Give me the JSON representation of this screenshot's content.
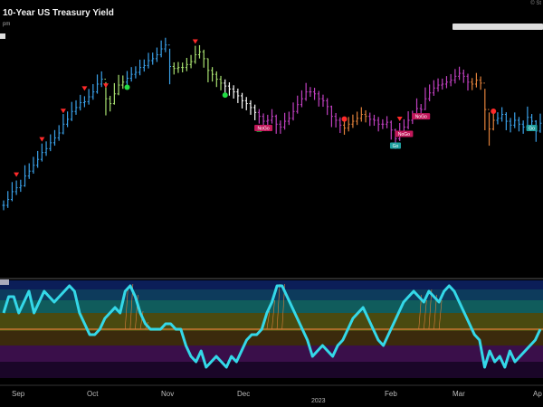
{
  "header": {
    "title": "10-Year US Treasury Yield",
    "subtitle": "pm",
    "copyright": "© St"
  },
  "chart_data": {
    "type": "line",
    "title": "10-Year US Treasury Yield",
    "x_axis_ticks": [
      "Sep",
      "Oct",
      "Nov",
      "Dec",
      "2023",
      "Feb",
      "Mar",
      "Ap"
    ],
    "price_panel": {
      "style": "colored OHLC bars",
      "series": [
        {
          "values": [
            2.72,
            2.78,
            2.86,
            2.9,
            2.92,
            3.02,
            3.07,
            3.13,
            3.19,
            3.26,
            3.3,
            3.36,
            3.41,
            3.46,
            3.55,
            3.6,
            3.68,
            3.72,
            3.77,
            3.78,
            3.83,
            3.88,
            3.96,
            4.01,
            3.81,
            3.76,
            3.86,
            3.95,
            3.98,
            4.02,
            4.06,
            4.08,
            4.13,
            4.15,
            4.2,
            4.22,
            4.26,
            4.32,
            4.36,
            4.14,
            4.12,
            4.13,
            4.13,
            4.16,
            4.19,
            4.26,
            4.29,
            4.22,
            4.1,
            4.06,
            4.01,
            3.97,
            3.94,
            3.91,
            3.88,
            3.84,
            3.79,
            3.76,
            3.72,
            3.67,
            3.63,
            3.58,
            3.59,
            3.63,
            3.55,
            3.52,
            3.58,
            3.61,
            3.68,
            3.75,
            3.81,
            3.88,
            3.88,
            3.86,
            3.81,
            3.79,
            3.73,
            3.63,
            3.59,
            3.54,
            3.51,
            3.55,
            3.58,
            3.61,
            3.65,
            3.63,
            3.6,
            3.59,
            3.55,
            3.55,
            3.57,
            3.49,
            3.4,
            3.47,
            3.52,
            3.59,
            3.62,
            3.71,
            3.7,
            3.81,
            3.87,
            3.92,
            3.95,
            3.96,
            3.98,
            4.0,
            4.04,
            4.07,
            4.04,
            3.98,
            3.96,
            4.0,
            3.97,
            3.7,
            3.5,
            3.59,
            3.61,
            3.65,
            3.58,
            3.54,
            3.59,
            3.55,
            3.52,
            3.62,
            3.58,
            3.48,
            3.56
          ]
        }
      ],
      "markers": [
        {
          "type": "down-triangle",
          "color": "#ff2a2a",
          "index": 3
        },
        {
          "type": "down-triangle",
          "color": "#ff2a2a",
          "index": 9
        },
        {
          "type": "down-triangle",
          "color": "#ff2a2a",
          "index": 14
        },
        {
          "type": "down-triangle",
          "color": "#ff2a2a",
          "index": 19
        },
        {
          "type": "down-triangle",
          "color": "#ff2a2a",
          "index": 24
        },
        {
          "type": "down-triangle",
          "color": "#ff2a2a",
          "index": 45
        },
        {
          "type": "down-triangle",
          "color": "#ff2a2a",
          "index": 93
        },
        {
          "type": "down-triangle",
          "color": "#ff2a2a",
          "index": 128
        },
        {
          "type": "down-triangle",
          "color": "#ff2a2a",
          "index": 137
        },
        {
          "type": "dot",
          "color": "#22dd44",
          "index": 29
        },
        {
          "type": "dot",
          "color": "#22dd44",
          "index": 52
        },
        {
          "type": "up-triangle",
          "color": "#22dd44",
          "index": 60
        },
        {
          "type": "dot",
          "color": "#ff2a2a",
          "index": 80
        },
        {
          "type": "dot",
          "color": "#ff2a2a",
          "index": 115
        }
      ],
      "labels": [
        {
          "text": "NoGo",
          "color": "#c2185b",
          "index": 61
        },
        {
          "text": "NoGo",
          "color": "#c2185b",
          "index": 94
        },
        {
          "text": "Go",
          "color": "#20a0a0",
          "index": 92
        },
        {
          "text": "NoGo",
          "color": "#c2185b",
          "index": 98
        },
        {
          "text": "Go",
          "color": "#20a0a0",
          "index": 124
        },
        {
          "text": "NoGo",
          "color": "#c2185b",
          "index": 145
        }
      ]
    },
    "oscillator_panel": {
      "series": [
        {
          "values": [
            1.5,
            3.0,
            3.0,
            1.5,
            2.5,
            3.5,
            1.5,
            2.5,
            3.5,
            3.0,
            2.5,
            3.0,
            3.5,
            4.0,
            3.5,
            1.5,
            0.5,
            -0.5,
            -0.5,
            0.0,
            1.0,
            1.5,
            2.0,
            1.5,
            3.5,
            4.0,
            3.0,
            1.5,
            0.5,
            0.0,
            0.0,
            0.0,
            0.5,
            0.5,
            0.0,
            0.0,
            -1.5,
            -2.5,
            -3.0,
            -2.0,
            -3.5,
            -3.0,
            -2.5,
            -3.0,
            -3.5,
            -2.5,
            -3.0,
            -2.0,
            -1.0,
            -0.5,
            -0.5,
            0.0,
            1.5,
            2.5,
            4.0,
            4.0,
            3.0,
            2.0,
            1.0,
            0.0,
            -1.0,
            -2.5,
            -2.0,
            -1.5,
            -2.0,
            -2.5,
            -1.5,
            -1.0,
            0.0,
            1.0,
            1.5,
            2.0,
            1.0,
            0.0,
            -1.0,
            -1.5,
            -0.5,
            0.5,
            1.5,
            2.5,
            3.0,
            3.5,
            3.0,
            2.5,
            3.5,
            3.0,
            2.5,
            3.5,
            4.0,
            3.5,
            2.5,
            1.5,
            0.5,
            -0.5,
            -1.0,
            -3.5,
            -2.0,
            -3.0,
            -2.5,
            -3.5,
            -2.0,
            -3.0,
            -2.5,
            -2.0,
            -1.5,
            -1.0,
            0.0
          ]
        }
      ],
      "zero_line": 0
    }
  }
}
